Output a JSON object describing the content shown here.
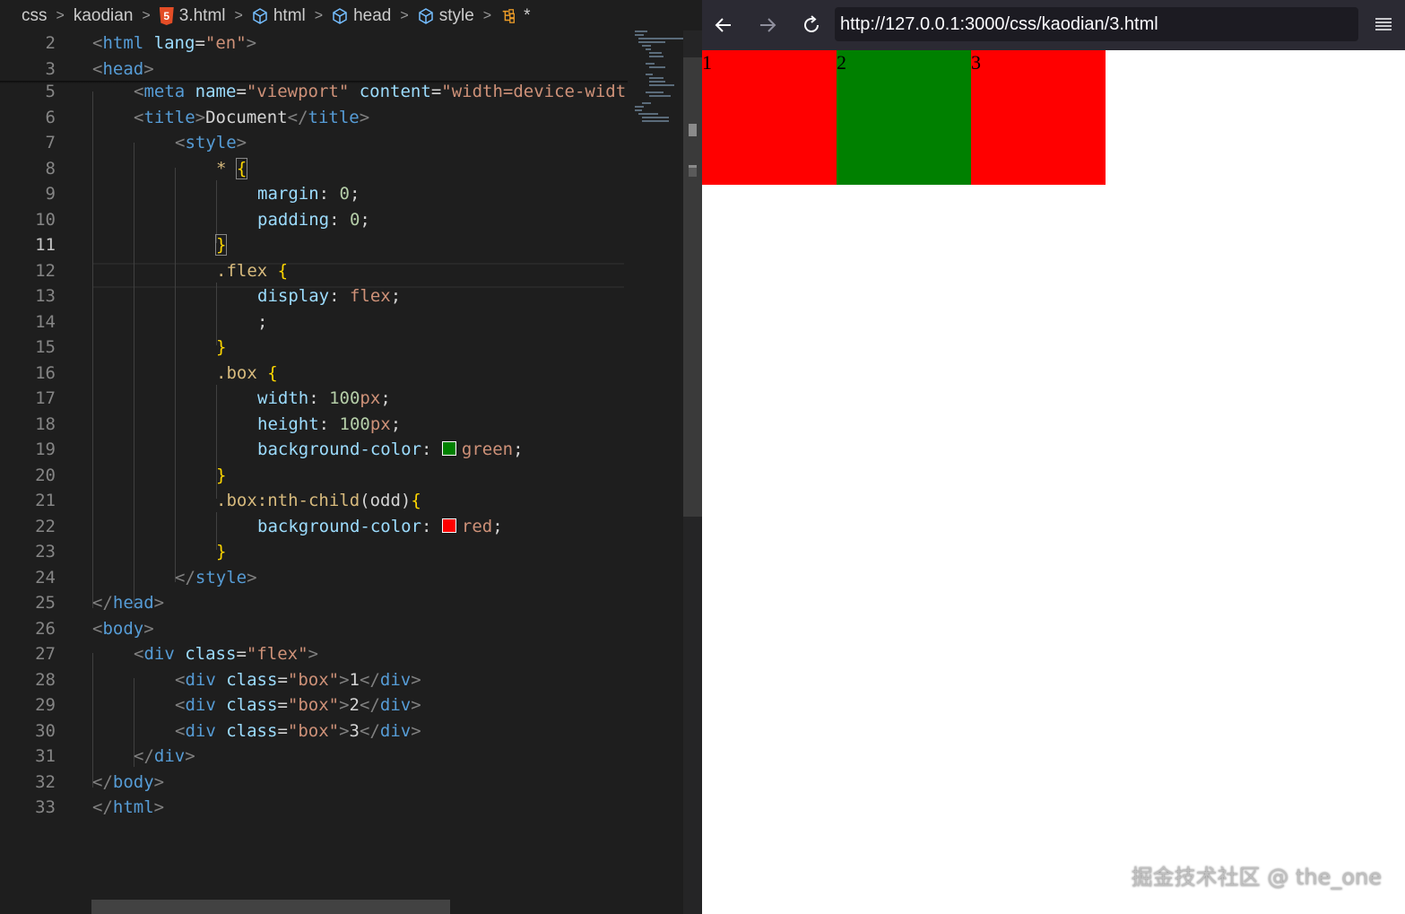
{
  "breadcrumb": {
    "items": [
      "css",
      "kaodian",
      "3.html",
      "html",
      "head",
      "style"
    ],
    "dirty_marker": "*"
  },
  "code_lines": [
    {
      "n": "2"
    },
    {
      "n": "3"
    },
    {
      "n": "5"
    },
    {
      "n": "6"
    },
    {
      "n": "7"
    },
    {
      "n": "8"
    },
    {
      "n": "9"
    },
    {
      "n": "10"
    },
    {
      "n": "11"
    },
    {
      "n": "12"
    },
    {
      "n": "13"
    },
    {
      "n": "14"
    },
    {
      "n": "15"
    },
    {
      "n": "16"
    },
    {
      "n": "17"
    },
    {
      "n": "18"
    },
    {
      "n": "19"
    },
    {
      "n": "20"
    },
    {
      "n": "21"
    },
    {
      "n": "22"
    },
    {
      "n": "23"
    },
    {
      "n": "24"
    },
    {
      "n": "25"
    },
    {
      "n": "26"
    },
    {
      "n": "27"
    },
    {
      "n": "28"
    },
    {
      "n": "29"
    },
    {
      "n": "30"
    },
    {
      "n": "31"
    },
    {
      "n": "32"
    },
    {
      "n": "33"
    }
  ],
  "code": {
    "l2": {
      "tag": "html",
      "attr": "lang",
      "val": "\"en\""
    },
    "l3": {
      "tag": "head"
    },
    "l5": {
      "tag": "meta",
      "attr1": "name",
      "val1": "\"viewport\"",
      "attr2": "content",
      "val2": "\"width=device-widt"
    },
    "l6": {
      "tag": "title",
      "text": "Document"
    },
    "l7": {
      "tag": "style"
    },
    "l8": {
      "sel": "*",
      "brace": "{"
    },
    "l9": {
      "prop": "margin",
      "val": "0"
    },
    "l10": {
      "prop": "padding",
      "val": "0"
    },
    "l11": {
      "brace": "}"
    },
    "l12": {
      "sel": ".flex",
      "brace": "{"
    },
    "l13": {
      "prop": "display",
      "val": "flex"
    },
    "l14": {
      "text": ";"
    },
    "l15": {
      "brace": "}"
    },
    "l16": {
      "sel": ".box",
      "brace": "{"
    },
    "l17": {
      "prop": "width",
      "num": "100",
      "unit": "px"
    },
    "l18": {
      "prop": "height",
      "num": "100",
      "unit": "px"
    },
    "l19": {
      "prop": "background-color",
      "val": "green",
      "swatch": "#008000"
    },
    "l20": {
      "brace": "}"
    },
    "l21": {
      "sel": ".box",
      "pseudo": ":nth-child",
      "arg": "(odd)",
      "brace": "{"
    },
    "l22": {
      "prop": "background-color",
      "val": "red",
      "swatch": "#ff0000"
    },
    "l23": {
      "brace": "}"
    },
    "l24": {
      "tag": "style"
    },
    "l25": {
      "tag": "head"
    },
    "l26": {
      "tag": "body"
    },
    "l27": {
      "tag": "div",
      "attr": "class",
      "val": "\"flex\""
    },
    "l28": {
      "tag": "div",
      "attr": "class",
      "val": "\"box\"",
      "text": "1"
    },
    "l29": {
      "tag": "div",
      "attr": "class",
      "val": "\"box\"",
      "text": "2"
    },
    "l30": {
      "tag": "div",
      "attr": "class",
      "val": "\"box\"",
      "text": "3"
    },
    "l31": {
      "tag": "div"
    },
    "l32": {
      "tag": "body"
    },
    "l33": {
      "tag": "html"
    }
  },
  "browser": {
    "url": "http://127.0.0.1:3000/css/kaodian/3.html",
    "boxes": [
      {
        "label": "1",
        "color": "#ff0000"
      },
      {
        "label": "2",
        "color": "#008000"
      },
      {
        "label": "3",
        "color": "#ff0000"
      }
    ]
  },
  "watermark": "掘金技术社区 @ the_one"
}
